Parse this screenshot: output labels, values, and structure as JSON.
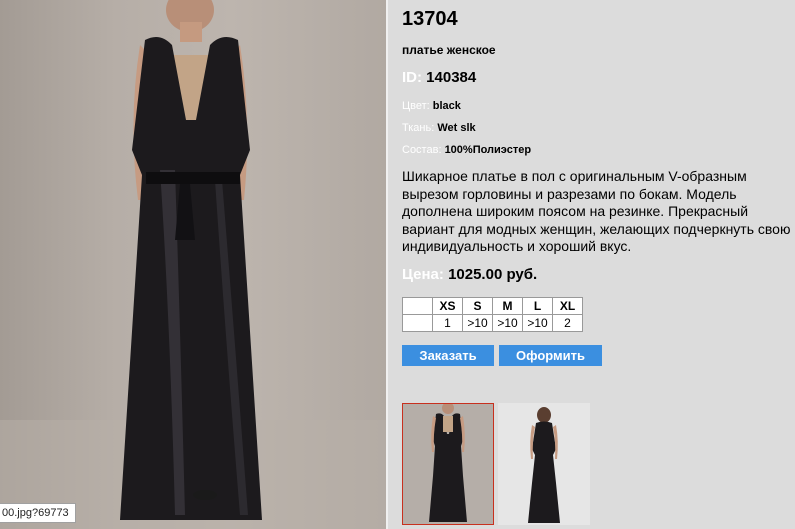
{
  "product": {
    "title": "13704",
    "subtitle": "платье женское",
    "id_label": "ID:",
    "id_value": "140384",
    "color_label": "Цвет:",
    "color_value": "black",
    "fabric_label": "Ткань:",
    "fabric_value": "Wet slk",
    "composition_label": "Состав:",
    "composition_value": "100%Полиэстер",
    "description": "Шикарное платье в пол с оригинальным  V-образным вырезом горловины и разрезами по бокам. Модель дополнена широким поясом на резинке. Прекрасный вариант для модных женщин, желающих подчеркнуть свою индивидуальность и хороший вкус.",
    "price_label": "Цена:",
    "price_value": "1025.00 руб."
  },
  "sizes": {
    "headers": [
      "XS",
      "S",
      "M",
      "L",
      "XL"
    ],
    "stock": [
      "1",
      ">10",
      ">10",
      ">10",
      "2"
    ]
  },
  "buttons": {
    "order": "Заказать",
    "checkout": "Оформить"
  },
  "status_url": "00.jpg?69773",
  "thumbnails": [
    {
      "icon": "dress-front-thumbnail",
      "selected": true
    },
    {
      "icon": "dress-back-thumbnail",
      "selected": false
    }
  ],
  "colors": {
    "accent_button": "#3b8fe0",
    "thumb_selected_border": "#c8301e",
    "background": "#dcdcdc"
  }
}
